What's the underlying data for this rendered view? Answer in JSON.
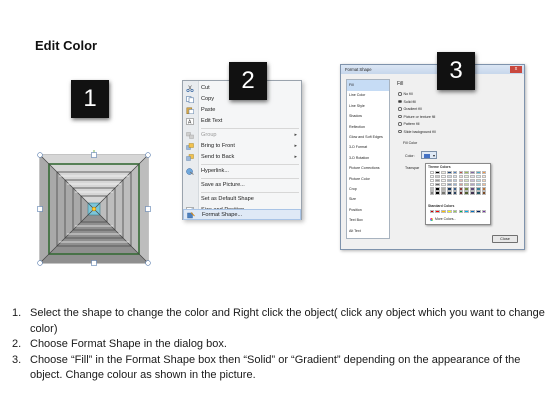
{
  "page": {
    "title": "Edit Color"
  },
  "steps": {
    "badge_1": "1",
    "badge_2": "2",
    "badge_3": "3"
  },
  "context_menu": {
    "items": [
      {
        "label": "Cut",
        "icon": "scissors-icon",
        "enabled": true,
        "submenu": false,
        "highlighted": false
      },
      {
        "label": "Copy",
        "icon": "copy-icon",
        "enabled": true,
        "submenu": false,
        "highlighted": false
      },
      {
        "label": "Paste",
        "icon": "paste-icon",
        "enabled": true,
        "submenu": false,
        "highlighted": false
      },
      {
        "label": "Edit Text",
        "icon": "text-box-icon",
        "enabled": true,
        "submenu": false,
        "highlighted": false
      },
      {
        "label": "Group",
        "icon": "group-icon",
        "enabled": false,
        "submenu": true,
        "highlighted": false
      },
      {
        "label": "Bring to Front",
        "icon": "bring-front-icon",
        "enabled": true,
        "submenu": true,
        "highlighted": false
      },
      {
        "label": "Send to Back",
        "icon": "send-back-icon",
        "enabled": true,
        "submenu": true,
        "highlighted": false
      },
      {
        "label": "Hyperlink...",
        "icon": "hyperlink-icon",
        "enabled": true,
        "submenu": false,
        "highlighted": false
      },
      {
        "label": "Save as Picture...",
        "icon": "",
        "enabled": true,
        "submenu": false,
        "highlighted": false
      },
      {
        "label": "Set as Default Shape",
        "icon": "",
        "enabled": true,
        "submenu": false,
        "highlighted": false
      },
      {
        "label": "Size and Position...",
        "icon": "size-position-icon",
        "enabled": true,
        "submenu": false,
        "highlighted": false
      },
      {
        "label": "Format Shape...",
        "icon": "format-shape-icon",
        "enabled": true,
        "submenu": false,
        "highlighted": true
      }
    ]
  },
  "dialog": {
    "title": "Format Shape",
    "close_label": "x",
    "categories": [
      "Fill",
      "Line Color",
      "Line Style",
      "Shadow",
      "Reflection",
      "Glow and Soft Edges",
      "3-D Format",
      "3-D Rotation",
      "Picture Corrections",
      "Picture Color",
      "Crop",
      "Size",
      "Position",
      "Text Box",
      "Alt Text"
    ],
    "selected_category": "Fill",
    "fill_heading": "Fill",
    "fill_options": [
      {
        "label": "No fill",
        "selected": false
      },
      {
        "label": "Solid fill",
        "selected": true
      },
      {
        "label": "Gradient fill",
        "selected": false
      },
      {
        "label": "Picture or texture fill",
        "selected": false
      },
      {
        "label": "Pattern fill",
        "selected": false
      },
      {
        "label": "Slide background fill",
        "selected": false
      }
    ],
    "fill_color_label": "Fill Color",
    "color_label": "Color:",
    "transparency_label": "Transpar",
    "palette": {
      "theme_heading": "Theme Colors",
      "standard_heading": "Standard Colors",
      "more_colors": "More Colors...",
      "theme_colors": [
        "#ffffff",
        "#000000",
        "#eeece1",
        "#1f497d",
        "#4f81bd",
        "#c0504d",
        "#9bbb59",
        "#8064a2",
        "#4bacc6",
        "#f79646"
      ],
      "standard_colors": [
        "#c00000",
        "#ff0000",
        "#ffc000",
        "#ffff00",
        "#92d050",
        "#00b050",
        "#00b0f0",
        "#0070c0",
        "#002060",
        "#7030a0"
      ]
    },
    "close_button": "Close"
  },
  "instructions": [
    {
      "num": "1.",
      "text": "Select the shape to change the color and Right click the object( click any object which you want to change color)"
    },
    {
      "num": "2.",
      "text": "Choose Format Shape in the dialog box."
    },
    {
      "num": "3.",
      "text": "Choose “Fill” in the Format Shape box then “Solid” or “Gradient” depending on the appearance of the object. Change colour as shown in the picture."
    }
  ]
}
